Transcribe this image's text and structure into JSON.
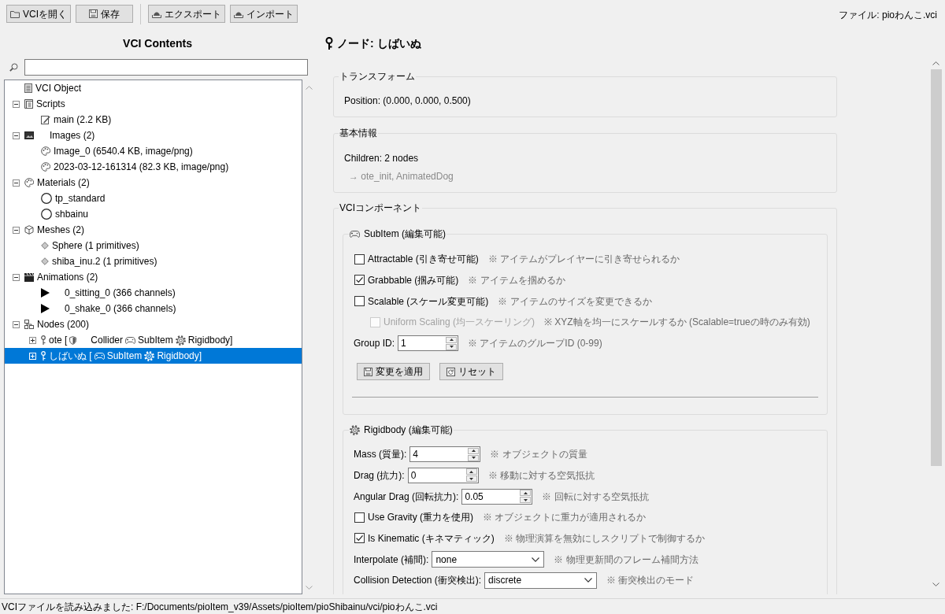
{
  "toolbar": [
    {
      "buttons": [
        {
          "kind": "open",
          "label": "VCIを開く"
        },
        {
          "kind": "save",
          "label": "保存"
        }
      ]
    },
    {
      "buttons": [
        {
          "kind": "export",
          "label": "エクスポート"
        },
        {
          "kind": "import",
          "label": "インポート"
        }
      ]
    }
  ],
  "file_label": "ファイル: pioわんこ.vci",
  "tree_panel": {
    "title": "VCI Contents",
    "items": [
      {
        "kind": "object",
        "label": "VCI Object",
        "selected": false
      },
      {
        "kind": "scripts",
        "label": "Scripts",
        "expanded": true,
        "selected": false,
        "children": [
          {
            "kind": "script",
            "label": "main (2.2 KB)",
            "selected": false
          }
        ]
      },
      {
        "kind": "images",
        "label": "Images (2)",
        "expanded": true,
        "selected": false,
        "children": [
          {
            "kind": "image",
            "label": "Image_0 (6540.4 KB, image/png)",
            "selected": false
          },
          {
            "kind": "image",
            "label": "2023-03-12-161314 (82.3 KB, image/png)",
            "selected": false
          }
        ]
      },
      {
        "kind": "materials",
        "label": "Materials (2)",
        "expanded": true,
        "selected": false,
        "children": [
          {
            "kind": "material",
            "label": "tp_standard",
            "selected": false
          },
          {
            "kind": "material",
            "label": "shbainu",
            "selected": false
          }
        ]
      },
      {
        "kind": "meshes",
        "label": "Meshes (2)",
        "expanded": true,
        "selected": false,
        "children": [
          {
            "kind": "mesh",
            "label": "Sphere (1 primitives)",
            "selected": false
          },
          {
            "kind": "mesh",
            "label": "shiba_inu.2 (1 primitives)",
            "selected": false
          }
        ]
      },
      {
        "kind": "animations",
        "label": "Animations (2)",
        "expanded": true,
        "selected": false,
        "children": [
          {
            "kind": "animation",
            "label": "0_sitting_0 (366 channels)",
            "selected": false
          },
          {
            "kind": "animation",
            "label": "0_shake_0 (366 channels)",
            "selected": false
          }
        ]
      },
      {
        "kind": "nodes",
        "label": "Nodes (200)",
        "expanded": true,
        "selected": false,
        "children": [
          {
            "kind": "node",
            "label": "ote [",
            "expanded": false,
            "selected": false,
            "tags": [
              {
                "kind": "collider",
                "label": "Collider"
              },
              {
                "kind": "subitem",
                "label": "SubItem"
              },
              {
                "kind": "rigidbody",
                "label": "Rigidbody]"
              }
            ]
          },
          {
            "kind": "node",
            "label": "しばいぬ [",
            "expanded": false,
            "selected": true,
            "tags": [
              {
                "kind": "subitem",
                "label": "SubItem"
              },
              {
                "kind": "rigidbody",
                "label": "Rigidbody]"
              }
            ]
          }
        ]
      }
    ]
  },
  "detail": {
    "title": "ノード: しばいぬ",
    "transform": {
      "title": "トランスフォーム",
      "position": "Position: (0.000, 0.000, 0.500)"
    },
    "basic_info": {
      "title": "基本情報",
      "children_count": "Children: 2 nodes",
      "children_names": "→ ote_init, AnimatedDog"
    },
    "components": {
      "title": "VCIコンポーネント",
      "sections": [
        {
          "kind": "subitem",
          "title": "SubItem (編集可能)",
          "fields": [
            {
              "kind": "checkbox",
              "label": "Attractable (引き寄せ可能)",
              "checked": false,
              "disabled": false,
              "hint": "※ アイテムがプレイヤーに引き寄せられるか"
            },
            {
              "kind": "checkbox",
              "label": "Grabbable (掴み可能)",
              "checked": true,
              "disabled": false,
              "hint": "※ アイテムを掴めるか"
            },
            {
              "kind": "checkbox",
              "label": "Scalable (スケール変更可能)",
              "checked": false,
              "disabled": false,
              "hint": "※ アイテムのサイズを変更できるか",
              "children": [
                {
                  "kind": "checkbox",
                  "label": "Uniform Scaling (均一スケーリング)",
                  "checked": false,
                  "disabled": true,
                  "hint": "※ XYZ軸を均一にスケールするか (Scalable=trueの時のみ有効)"
                }
              ]
            },
            {
              "kind": "spinner",
              "label": "Group ID:",
              "value": "1",
              "hint": "※ アイテムのグループID (0-99)"
            }
          ],
          "buttons": [
            {
              "kind": "apply",
              "label": "変更を適用"
            },
            {
              "kind": "reset",
              "label": "リセット"
            }
          ]
        },
        {
          "kind": "rigidbody",
          "title": "Rigidbody (編集可能)",
          "fields": [
            {
              "kind": "spinner",
              "label": "Mass (質量):",
              "value": "4",
              "hint": "※ オブジェクトの質量"
            },
            {
              "kind": "spinner",
              "label": "Drag (抗力):",
              "value": "0",
              "hint": "※ 移動に対する空気抵抗"
            },
            {
              "kind": "spinner",
              "label": "Angular Drag (回転抗力):",
              "value": "0.05",
              "hint": "※ 回転に対する空気抵抗"
            },
            {
              "kind": "checkbox",
              "label": "Use Gravity (重力を使用)",
              "checked": false,
              "disabled": false,
              "hint": "※ オブジェクトに重力が適用されるか"
            },
            {
              "kind": "checkbox",
              "label": "Is Kinematic (キネマティック)",
              "checked": true,
              "disabled": false,
              "hint": "※ 物理演算を無効にしスクリプトで制御するか"
            },
            {
              "kind": "select",
              "label": "Interpolate (補間):",
              "value": "none",
              "hint": "※ 物理更新間のフレーム補間方法"
            },
            {
              "kind": "select",
              "label": "Collision Detection (衝突検出):",
              "value": "discrete",
              "hint": "※ 衝突検出のモード"
            }
          ]
        }
      ]
    }
  },
  "status_bar": "VCIファイルを読み込みました: F:/Documents/pioItem_v39/Assets/pioItem/pioShibainu/vci/pioわんこ.vci"
}
